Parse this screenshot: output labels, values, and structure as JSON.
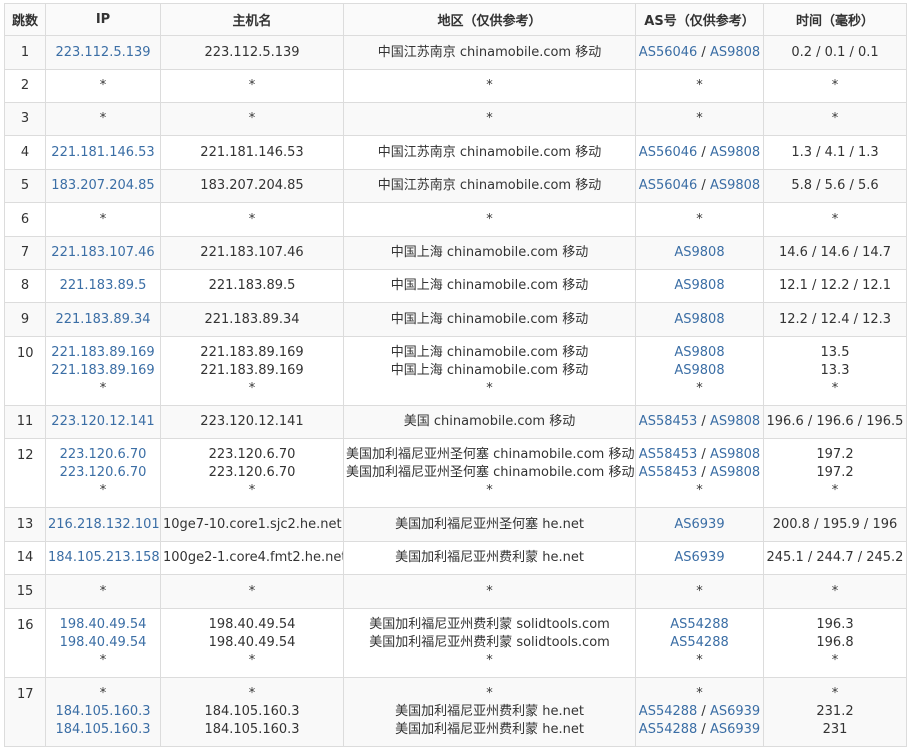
{
  "headers": {
    "hop": "跳数",
    "ip": "IP",
    "host": "主机名",
    "region": "地区（仅供参考）",
    "asn": "AS号（仅供参考）",
    "time": "时间（毫秒）"
  },
  "rows": [
    {
      "hop": "1",
      "height": 34,
      "lines": [
        {
          "ip": "223.112.5.139",
          "host": "223.112.5.139",
          "region": "中国江苏南京 chinamobile.com 移动",
          "as": [
            "AS56046",
            "AS9808"
          ],
          "time": "0.2 / 0.1 / 0.1"
        }
      ]
    },
    {
      "hop": "2",
      "height": 33,
      "lines": [
        {
          "ip": "*",
          "host": "*",
          "region": "*",
          "as": [
            "*"
          ],
          "time": "*"
        }
      ]
    },
    {
      "hop": "3",
      "height": 33,
      "lines": [
        {
          "ip": "*",
          "host": "*",
          "region": "*",
          "as": [
            "*"
          ],
          "time": "*"
        }
      ]
    },
    {
      "hop": "4",
      "height": 34,
      "lines": [
        {
          "ip": "221.181.146.53",
          "host": "221.181.146.53",
          "region": "中国江苏南京 chinamobile.com 移动",
          "as": [
            "AS56046",
            "AS9808"
          ],
          "time": "1.3 / 4.1 / 1.3"
        }
      ]
    },
    {
      "hop": "5",
      "height": 33,
      "lines": [
        {
          "ip": "183.207.204.85",
          "host": "183.207.204.85",
          "region": "中国江苏南京 chinamobile.com 移动",
          "as": [
            "AS56046",
            "AS9808"
          ],
          "time": "5.8 / 5.6 / 5.6"
        }
      ]
    },
    {
      "hop": "6",
      "height": 34,
      "lines": [
        {
          "ip": "*",
          "host": "*",
          "region": "*",
          "as": [
            "*"
          ],
          "time": "*"
        }
      ]
    },
    {
      "hop": "7",
      "height": 33,
      "lines": [
        {
          "ip": "221.183.107.46",
          "host": "221.183.107.46",
          "region": "中国上海 chinamobile.com 移动",
          "as": [
            "AS9808"
          ],
          "time": "14.6 / 14.6 / 14.7"
        }
      ]
    },
    {
      "hop": "8",
      "height": 33,
      "lines": [
        {
          "ip": "221.183.89.5",
          "host": "221.183.89.5",
          "region": "中国上海 chinamobile.com 移动",
          "as": [
            "AS9808"
          ],
          "time": "12.1 / 12.2 / 12.1"
        }
      ]
    },
    {
      "hop": "9",
      "height": 34,
      "lines": [
        {
          "ip": "221.183.89.34",
          "host": "221.183.89.34",
          "region": "中国上海 chinamobile.com 移动",
          "as": [
            "AS9808"
          ],
          "time": "12.2 / 12.4 / 12.3"
        }
      ]
    },
    {
      "hop": "10",
      "height": 69,
      "lines": [
        {
          "ip": "221.183.89.169",
          "host": "221.183.89.169",
          "region": "中国上海 chinamobile.com 移动",
          "as": [
            "AS9808"
          ],
          "time": "13.5"
        },
        {
          "ip": "221.183.89.169",
          "host": "221.183.89.169",
          "region": "中国上海 chinamobile.com 移动",
          "as": [
            "AS9808"
          ],
          "time": "13.3"
        },
        {
          "ip": "*",
          "host": "*",
          "region": "*",
          "as": [
            "*"
          ],
          "time": "*"
        }
      ]
    },
    {
      "hop": "11",
      "height": 33,
      "lines": [
        {
          "ip": "223.120.12.141",
          "host": "223.120.12.141",
          "region": "美国 chinamobile.com 移动",
          "as": [
            "AS58453",
            "AS9808"
          ],
          "time": "196.6 / 196.6 / 196.5"
        }
      ]
    },
    {
      "hop": "12",
      "height": 69,
      "lines": [
        {
          "ip": "223.120.6.70",
          "host": "223.120.6.70",
          "region": "美国加利福尼亚州圣何塞 chinamobile.com 移动",
          "as": [
            "AS58453",
            "AS9808"
          ],
          "time": "197.2"
        },
        {
          "ip": "223.120.6.70",
          "host": "223.120.6.70",
          "region": "美国加利福尼亚州圣何塞 chinamobile.com 移动",
          "as": [
            "AS58453",
            "AS9808"
          ],
          "time": "197.2"
        },
        {
          "ip": "*",
          "host": "*",
          "region": "*",
          "as": [
            "*"
          ],
          "time": "*"
        }
      ]
    },
    {
      "hop": "13",
      "height": 34,
      "lines": [
        {
          "ip": "216.218.132.101",
          "host": "10ge7-10.core1.sjc2.he.net",
          "region": "美国加利福尼亚州圣何塞 he.net",
          "as": [
            "AS6939"
          ],
          "time": "200.8 / 195.9 / 196"
        }
      ]
    },
    {
      "hop": "14",
      "height": 33,
      "lines": [
        {
          "ip": "184.105.213.158",
          "host": "100ge2-1.core4.fmt2.he.net",
          "region": "美国加利福尼亚州费利蒙 he.net",
          "as": [
            "AS6939"
          ],
          "time": "245.1 / 244.7 / 245.2"
        }
      ]
    },
    {
      "hop": "15",
      "height": 34,
      "lines": [
        {
          "ip": "*",
          "host": "*",
          "region": "*",
          "as": [
            "*"
          ],
          "time": "*"
        }
      ]
    },
    {
      "hop": "16",
      "height": 69,
      "lines": [
        {
          "ip": "198.40.49.54",
          "host": "198.40.49.54",
          "region": "美国加利福尼亚州费利蒙 solidtools.com",
          "as": [
            "AS54288"
          ],
          "time": "196.3"
        },
        {
          "ip": "198.40.49.54",
          "host": "198.40.49.54",
          "region": "美国加利福尼亚州费利蒙 solidtools.com",
          "as": [
            "AS54288"
          ],
          "time": "196.8"
        },
        {
          "ip": "*",
          "host": "*",
          "region": "*",
          "as": [
            "*"
          ],
          "time": "*"
        }
      ]
    },
    {
      "hop": "17",
      "height": 69,
      "lines": [
        {
          "ip": "*",
          "host": "*",
          "region": "*",
          "as": [
            "*"
          ],
          "time": "*"
        },
        {
          "ip": "184.105.160.3",
          "host": "184.105.160.3",
          "region": "美国加利福尼亚州费利蒙 he.net",
          "as": [
            "AS54288",
            "AS6939"
          ],
          "time": "231.2"
        },
        {
          "ip": "184.105.160.3",
          "host": "184.105.160.3",
          "region": "美国加利福尼亚州费利蒙 he.net",
          "as": [
            "AS54288",
            "AS6939"
          ],
          "time": "231"
        }
      ]
    }
  ],
  "colors": {
    "link": "#3b6ea5",
    "text": "#333333",
    "border": "#dcdcdc",
    "stripe": "#f9f9f9"
  }
}
